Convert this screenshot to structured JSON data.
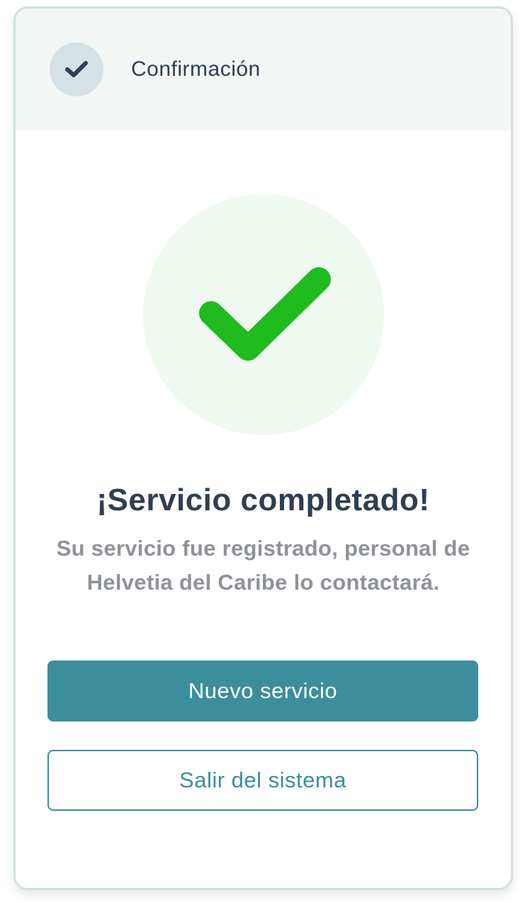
{
  "header": {
    "step_icon": "check-icon",
    "step_title": "Confirmación"
  },
  "success": {
    "icon": "check-icon",
    "accent_color": "#1fbb1f",
    "title": "¡Servicio completado!",
    "message": "Su servicio fue registrado, personal de Helvetia del Caribe lo contactará."
  },
  "actions": {
    "primary_label": "Nuevo servicio",
    "secondary_label": "Salir del sistema",
    "brand_color": "#3c8e9c"
  }
}
